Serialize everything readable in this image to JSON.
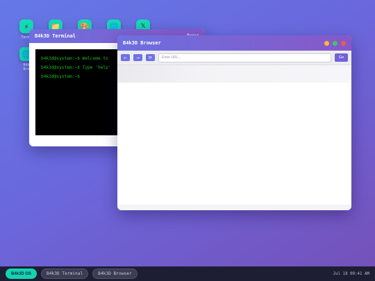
{
  "desktop": {
    "icons": [
      {
        "label": "Termi",
        "glyph": "⚡",
        "icon": "lightning-icon"
      },
      {
        "label": "",
        "glyph": "📁",
        "icon": "folder-icon"
      },
      {
        "label": "",
        "glyph": "🎨",
        "icon": "palette-icon"
      },
      {
        "label": "",
        "glyph": "🌐",
        "icon": "globe-icon"
      },
      {
        "label": "",
        "glyph": "𝕏",
        "icon": "x-icon"
      },
      {
        "label": "B4k\nBro",
        "glyph": "🌐",
        "icon": "globe-icon"
      }
    ]
  },
  "terminal": {
    "title": "B4k3D Terminal",
    "hint": "Press",
    "lines": [
      "b4k3d@system:~$ Welcome to",
      "b4k3d@system:~$ Type 'help'",
      "b4k3d@system:~$"
    ]
  },
  "browser": {
    "title": "B4k3D Browser",
    "back": "←",
    "forward": "→",
    "reload": "⟳",
    "url_placeholder": "Enter URL...",
    "go": "Go"
  },
  "colors": {
    "minimize": "#f5b940",
    "maximize": "#3ec46a",
    "close": "#ea5a5a",
    "accent": "#14d4b0"
  },
  "taskbar": {
    "start": "B4k3D OS",
    "tasks": [
      "B4k3D Terminal",
      "B4k3D Browser"
    ],
    "clock": "Jul 18 09:41 AM"
  }
}
